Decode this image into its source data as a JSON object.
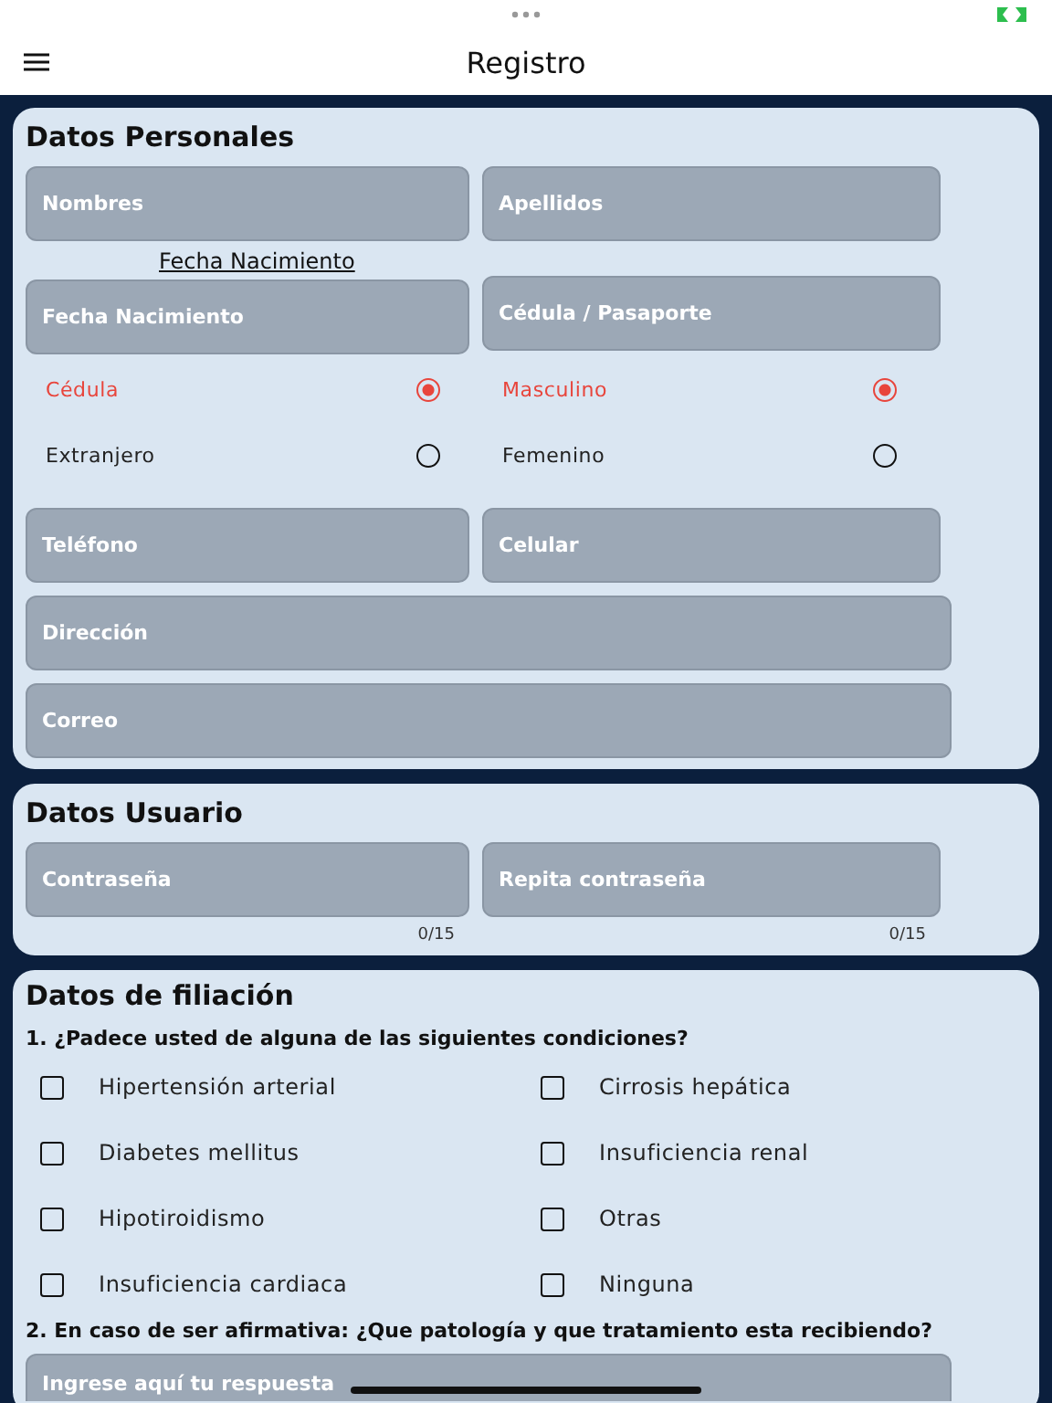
{
  "header": {
    "title": "Registro"
  },
  "personal": {
    "title": "Datos Personales",
    "name_fields": [
      {
        "placeholder": "Nombres"
      },
      {
        "placeholder": "Apellidos"
      }
    ],
    "birth_link": "Fecha Nacimiento",
    "id_fields": [
      {
        "placeholder": "Fecha Nacimiento"
      },
      {
        "placeholder": "Cédula / Pasaporte"
      }
    ],
    "document_options": [
      {
        "label": "Cédula",
        "selected": true
      },
      {
        "label": "Extranjero",
        "selected": false
      }
    ],
    "gender_options": [
      {
        "label": "Masculino",
        "selected": true
      },
      {
        "label": "Femenino",
        "selected": false
      }
    ],
    "phone_fields": [
      {
        "placeholder": "Teléfono"
      },
      {
        "placeholder": "Celular"
      }
    ],
    "wide_fields": [
      {
        "placeholder": "Dirección"
      },
      {
        "placeholder": "Correo"
      }
    ]
  },
  "user": {
    "title": "Datos Usuario",
    "fields": [
      {
        "placeholder": "Contraseña",
        "counter": "0/15"
      },
      {
        "placeholder": "Repita contraseña",
        "counter": "0/15"
      }
    ]
  },
  "filiation": {
    "title": "Datos de filiación",
    "question_1": "1. ¿Padece usted de alguna de las siguientes condiciones?",
    "conditions": [
      {
        "label": "Hipertensión arterial",
        "checked": false
      },
      {
        "label": "Cirrosis hepática",
        "checked": false
      },
      {
        "label": "Diabetes mellitus",
        "checked": false
      },
      {
        "label": "Insuficiencia renal",
        "checked": false
      },
      {
        "label": "Hipotiroidismo",
        "checked": false
      },
      {
        "label": "Otras",
        "checked": false
      },
      {
        "label": "Insuficiencia cardiaca",
        "checked": false
      },
      {
        "label": "Ninguna",
        "checked": false
      }
    ],
    "question_2": "2. En caso de ser afirmativa: ¿Que patología y que tratamiento esta recibiendo?",
    "answer": {
      "placeholder": "Ingrese aquí tu respuesta"
    }
  }
}
